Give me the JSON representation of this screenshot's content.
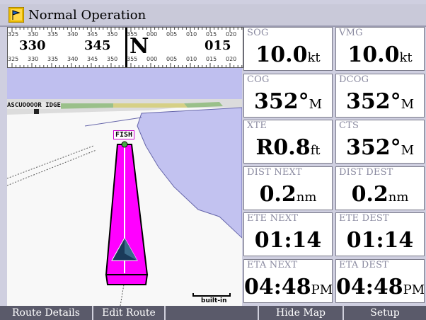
{
  "title": {
    "text": "Normal Operation",
    "icon": "route-flag-icon"
  },
  "compass": {
    "upper_ticks": [
      "325",
      "330",
      "335",
      "340",
      "345",
      "350",
      "355",
      "000",
      "005",
      "010",
      "015",
      "020"
    ],
    "lower_ticks": [
      "325",
      "330",
      "335",
      "340",
      "345",
      "350",
      "355",
      "000",
      "005",
      "010",
      "015",
      "020"
    ],
    "headings": [
      "330",
      "345",
      "N",
      "015"
    ]
  },
  "map": {
    "waypoint_label": "FISH",
    "place_label": "ASCUOOOOR IDGE",
    "scale_label": "built-in"
  },
  "fields": [
    {
      "label": "SOG",
      "value": "10.0",
      "unit": "kt"
    },
    {
      "label": "VMG",
      "value": "10.0",
      "unit": "kt"
    },
    {
      "label": "COG",
      "value": "352°",
      "unit": "M"
    },
    {
      "label": "DCOG",
      "value": "352°",
      "unit": "M"
    },
    {
      "label": "XTE",
      "value": "R0.8",
      "unit": "ft"
    },
    {
      "label": "CTS",
      "value": "352°",
      "unit": "M"
    },
    {
      "label": "DIST NEXT",
      "value": "0.2",
      "unit": "nm"
    },
    {
      "label": "DIST DEST",
      "value": "0.2",
      "unit": "nm"
    },
    {
      "label": "ETE NEXT",
      "value": "01:14",
      "unit": ""
    },
    {
      "label": "ETE DEST",
      "value": "01:14",
      "unit": ""
    },
    {
      "label": "ETA NEXT",
      "value": "04:48",
      "unit": "PM"
    },
    {
      "label": "ETA DEST",
      "value": "04:48",
      "unit": "PM"
    }
  ],
  "softkeys": [
    "Route Details",
    "Edit Route",
    "",
    "Hide Map",
    "Setup"
  ],
  "colors": {
    "water": "#bfbfef",
    "land": "#fafafa",
    "route": "#ff00ff",
    "boat": "#1a3a5a",
    "titlebar": "#c9c9d9"
  }
}
